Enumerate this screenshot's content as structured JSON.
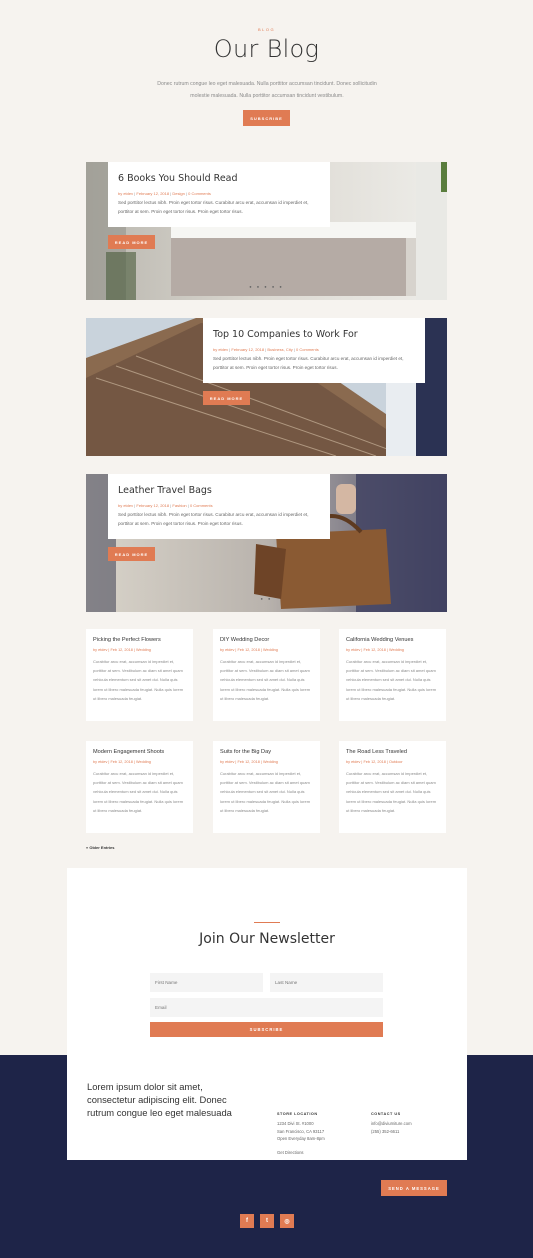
{
  "header": {
    "eyebrow": "BLOG",
    "title": "Our Blog",
    "intro": "Donec rutrum congue leo eget malesuada. Nulla porttitor accumsan tincidunt. Donec sollicitudin molestie malesuada. Nulla porttitor accumsan tincidunt vestibulum.",
    "subscribe_label": "SUBSCRIBE"
  },
  "featured": [
    {
      "title": "6 Books You Should Read",
      "author": "by etdev",
      "date": "February 12, 2018",
      "category": "Design",
      "comments": "0 Comments",
      "excerpt": "Sed porttitor lectus nibh. Proin eget tortor risus. Curabitur arcu erat, accumsan id imperdiet et, porttitor at sem. Proin eget tortor risus. Proin eget tortor risus.",
      "read_more": "READ MORE",
      "dots": "● ● ● ● ●"
    },
    {
      "title": "Top 10 Companies to Work For",
      "author": "by etdev",
      "date": "February 12, 2018",
      "category": "Business, City",
      "comments": "0 Comments",
      "excerpt": "Sed porttitor lectus nibh. Proin eget tortor risus. Curabitur arcu erat, accumsan id imperdiet et, porttitor at sem. Proin eget tortor risus. Proin eget tortor risus.",
      "read_more": "READ MORE"
    },
    {
      "title": "Leather Travel Bags",
      "author": "by etdev",
      "date": "February 12, 2018",
      "category": "Fashion",
      "comments": "0 Comments",
      "excerpt": "Sed porttitor lectus nibh. Proin eget tortor risus. Curabitur arcu erat, accumsan id imperdiet et, porttitor at sem. Proin eget tortor risus. Proin eget tortor risus.",
      "read_more": "READ MORE",
      "dots": "● ●"
    }
  ],
  "grid": [
    {
      "title": "Picking the Perfect Flowers",
      "author": "by etdev",
      "date": "Feb 12, 2018",
      "category": "Wedding",
      "excerpt": "Curabitur arcu erat, accumsan id imperdiet et, porttitor at sem. Vestibulum ac diam sit amet quam vehicula elementum sed sit amet dui. Nulla quis lorem ut libero malesuada feugiat. Nulla quis lorem ut libero malesuada feugiat."
    },
    {
      "title": "DIY Wedding Decor",
      "author": "by etdev",
      "date": "Feb 12, 2018",
      "category": "Wedding",
      "excerpt": "Curabitur arcu erat, accumsan id imperdiet et, porttitor at sem. Vestibulum ac diam sit amet quam vehicula elementum sed sit amet dui. Nulla quis lorem ut libero malesuada feugiat. Nulla quis lorem ut libero malesuada feugiat."
    },
    {
      "title": "California Wedding Venues",
      "author": "by etdev",
      "date": "Feb 12, 2018",
      "category": "Wedding",
      "excerpt": "Curabitur arcu erat, accumsan id imperdiet et, porttitor at sem. Vestibulum ac diam sit amet quam vehicula elementum sed sit amet dui. Nulla quis lorem ut libero malesuada feugiat. Nulla quis lorem ut libero malesuada feugiat."
    },
    {
      "title": "Modern Engagement Shoots",
      "author": "by etdev",
      "date": "Feb 12, 2018",
      "category": "Wedding",
      "excerpt": "Curabitur arcu erat, accumsan id imperdiet et, porttitor at sem. Vestibulum ac diam sit amet quam vehicula elementum sed sit amet dui. Nulla quis lorem ut libero malesuada feugiat. Nulla quis lorem ut libero malesuada feugiat."
    },
    {
      "title": "Suits for the Big Day",
      "author": "by etdev",
      "date": "Feb 12, 2018",
      "category": "Wedding",
      "excerpt": "Curabitur arcu erat, accumsan id imperdiet et, porttitor at sem. Vestibulum ac diam sit amet quam vehicula elementum sed sit amet dui. Nulla quis lorem ut libero malesuada feugiat. Nulla quis lorem ut libero malesuada feugiat."
    },
    {
      "title": "The Road Less Traveled",
      "author": "by etdev",
      "date": "Feb 12, 2018",
      "category": "Outdoor",
      "excerpt": "Curabitur arcu erat, accumsan id imperdiet et, porttitor at sem. Vestibulum ac diam sit amet quam vehicula elementum sed sit amet dui. Nulla quis lorem ut libero malesuada feugiat. Nulla quis lorem ut libero malesuada feugiat."
    }
  ],
  "pagination": {
    "older": "« Older Entries"
  },
  "newsletter": {
    "title": "Join Our Newsletter",
    "first_name_placeholder": "First Name",
    "last_name_placeholder": "Last Name",
    "email_placeholder": "Email",
    "subscribe_label": "SUBSCRIBE"
  },
  "footer": {
    "tagline": "Lorem ipsum dolor sit amet, consectetur adipiscing elit. Donec rutrum congue leo eget malesuada",
    "store_heading": "STORE LOCATION",
    "store_line1": "1234 Divi St. #1000",
    "store_line2": "San Francisco, CA 93117",
    "store_line3": "Open Everyday 8am-8pm",
    "directions": "Get Directions",
    "contact_heading": "CONTACT US",
    "contact_email": "info@diviurniture.com",
    "contact_phone": "(255) 352-6611",
    "send_message": "SEND A MESSAGE"
  },
  "social": [
    {
      "icon": "facebook-icon",
      "glyph": "f"
    },
    {
      "icon": "twitter-icon",
      "glyph": "t"
    },
    {
      "icon": "instagram-icon",
      "glyph": "◎"
    }
  ],
  "colors": {
    "accent": "#e07b53",
    "navy": "#1e2448",
    "background": "#f6f3ef"
  }
}
